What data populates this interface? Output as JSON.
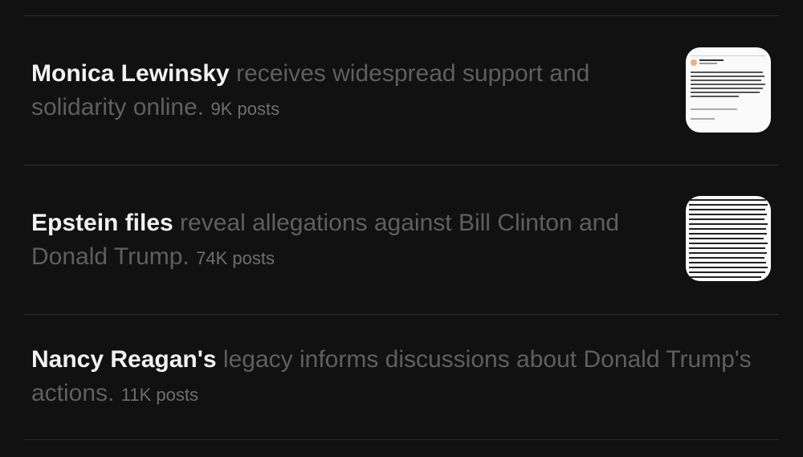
{
  "trends": [
    {
      "title": "Monica Lewinsky",
      "summary": " receives widespread support and solidarity online.",
      "posts": "9K posts",
      "has_thumbnail": true
    },
    {
      "title": "Epstein files",
      "summary": " reveal allegations against Bill Clinton and Donald Trump.",
      "posts": "74K posts",
      "has_thumbnail": true
    },
    {
      "title": "Nancy Reagan's",
      "summary": " legacy informs discussions about Donald Trump's actions.",
      "posts": "11K posts",
      "has_thumbnail": false
    }
  ],
  "colors": {
    "background": "#111111",
    "title": "#f2f2f2",
    "summary": "#5f5f5f",
    "divider": "#2c2c2c"
  }
}
